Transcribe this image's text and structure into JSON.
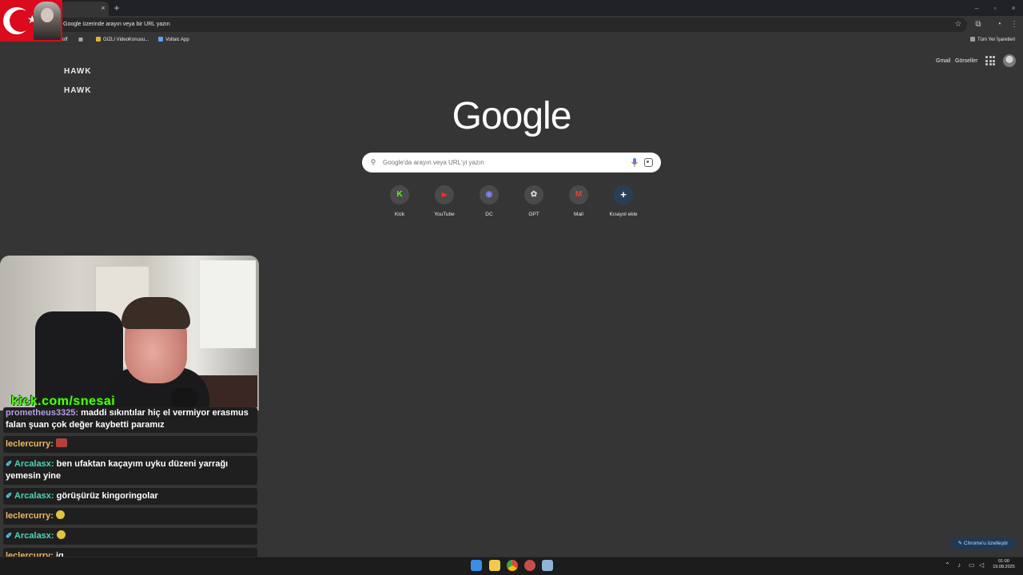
{
  "browser": {
    "tab_close": "×",
    "new_tab": "+",
    "window_controls": [
      "–",
      "▫",
      "×"
    ],
    "omnibox_text": "Google üzerinde arayın veya bir URL yazın",
    "bookmarks": [
      {
        "label": "off"
      },
      {
        "label": "GIZLI VideoKonusu..."
      },
      {
        "label": "Voltaic App"
      }
    ],
    "bookmarks_right": "Tüm Yer İşaretleri"
  },
  "ntp": {
    "top_links": [
      "Gmail",
      "Görseller"
    ],
    "logo": "Google",
    "search_placeholder": "Google'da arayın veya URL'yi yazın",
    "shortcuts": [
      {
        "label": "Kick",
        "glyph": "K",
        "color": "#53fc18",
        "icon": "kick-icon"
      },
      {
        "label": "YouTube",
        "glyph": "▶",
        "color": "#ff2a2a",
        "icon": "youtube-icon"
      },
      {
        "label": "DC",
        "glyph": "◉",
        "color": "#7d86f5",
        "icon": "discord-icon"
      },
      {
        "label": "GPT",
        "glyph": "✿",
        "color": "#d6d6d6",
        "icon": "openai-icon"
      },
      {
        "label": "Mail",
        "glyph": "M",
        "color": "#ea4335",
        "icon": "gmail-icon"
      },
      {
        "label": "Kısayol ekle",
        "glyph": "+",
        "color": "#ffffff",
        "icon": "add-shortcut-icon"
      }
    ],
    "customize_label": "Chrome'u özelleştir"
  },
  "stream": {
    "kick_url": "kick.com/snesai",
    "chair_text": "HAWK",
    "chat": [
      {
        "user": "prometheus3325:",
        "text": " maddi sıkıntılar hiç el vermiyor erasmus falan şuan çok değer kaybetti paramız",
        "user_color": "#b59ee7",
        "pinned": false
      },
      {
        "user": "leclercurry:",
        "text": "",
        "user_color": "#f0b75e",
        "pinned": false,
        "emote": "#b3413a"
      },
      {
        "user": "Arcalasx:",
        "text": " ben ufaktan kaçayım uyku düzeni yarrağı yemesin yine",
        "user_color": "#4fd6b8",
        "pinned": true
      },
      {
        "user": "Arcalasx:",
        "text": " görüşürüz kingoringolar",
        "user_color": "#4fd6b8",
        "pinned": true
      },
      {
        "user": "leclercurry:",
        "text": "",
        "user_color": "#f0b75e",
        "pinned": false,
        "emote": "#e0c43a"
      },
      {
        "user": "Arcalasx:",
        "text": "",
        "user_color": "#4fd6b8",
        "pinned": true,
        "emote": "#e0c43a"
      },
      {
        "user": "leclercurry:",
        "text": " ig",
        "user_color": "#f0b75e",
        "pinned": false
      }
    ]
  },
  "taskbar": {
    "clock_time": "01:00",
    "clock_date": "19.08.2025",
    "apps": [
      {
        "icon": "windows-start-icon",
        "color": "#3a8ee6"
      },
      {
        "icon": "file-explorer-icon",
        "color": "#f2c94c"
      },
      {
        "icon": "chrome-icon",
        "color": "#e8a23a"
      },
      {
        "icon": "chrome-alt-icon",
        "color": "#c94c4c"
      },
      {
        "icon": "steam-icon",
        "color": "#8fb3d9"
      }
    ]
  }
}
